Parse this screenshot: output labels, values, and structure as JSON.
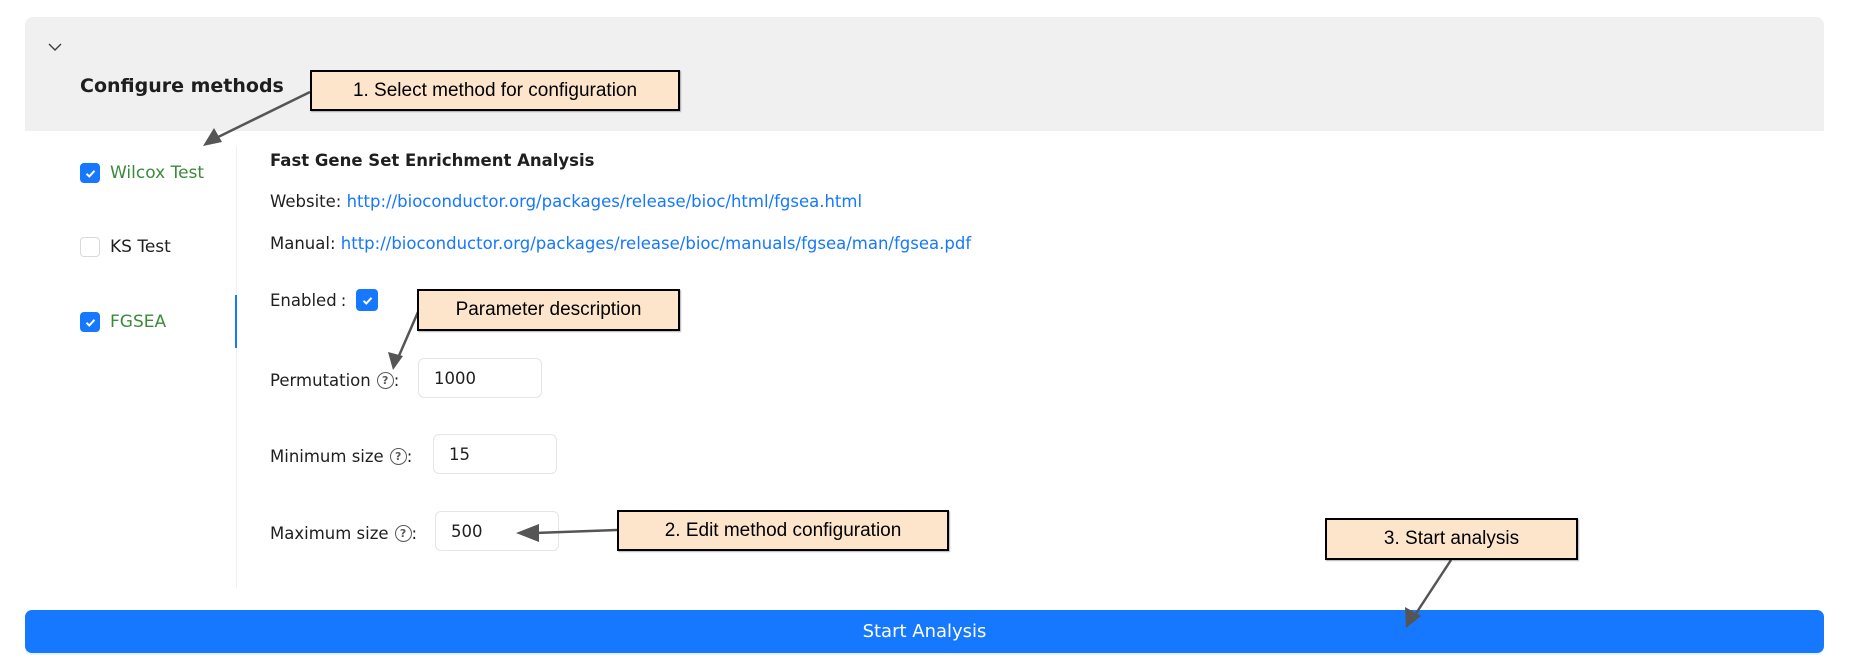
{
  "panel": {
    "title": "Configure methods",
    "collapse_icon": "chevron-down-icon"
  },
  "methods": [
    {
      "label": "Wilcox Test",
      "checked": true,
      "selected": false
    },
    {
      "label": "KS Test",
      "checked": false,
      "selected": false
    },
    {
      "label": "FGSEA",
      "checked": true,
      "selected": true
    }
  ],
  "detail": {
    "title": "Fast Gene Set Enrichment Analysis",
    "website_label": "Website:",
    "website_url": "http://bioconductor.org/packages/release/bioc/html/fgsea.html",
    "manual_label": "Manual:",
    "manual_url": "http://bioconductor.org/packages/release/bioc/manuals/fgsea/man/fgsea.pdf",
    "enabled_label": "Enabled",
    "enabled_colon": ":",
    "enabled": true,
    "params": [
      {
        "label": "Permutation",
        "value": "1000",
        "help_icon": "question-circle-icon"
      },
      {
        "label": "Minimum size",
        "value": "15",
        "help_icon": "question-circle-icon"
      },
      {
        "label": "Maximum size",
        "value": "500",
        "help_icon": "question-circle-icon"
      }
    ],
    "param_colon": ":"
  },
  "actions": {
    "start_label": "Start Analysis",
    "primary_color": "#1677ff"
  },
  "annotations": [
    {
      "text": "1. Select method for configuration"
    },
    {
      "text": "Parameter description"
    },
    {
      "text": "2. Edit method configuration"
    },
    {
      "text": "3. Start analysis"
    }
  ]
}
